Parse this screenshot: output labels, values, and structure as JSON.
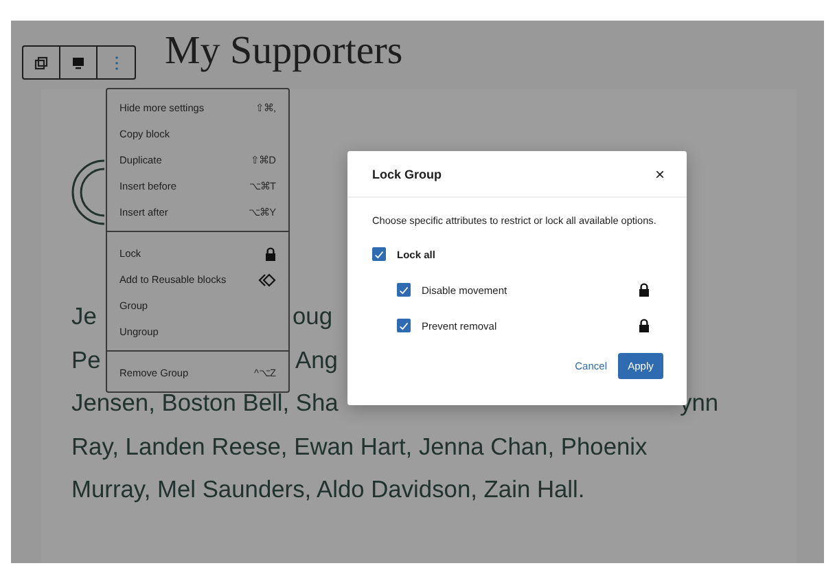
{
  "title": "My Supporters",
  "paragraph_lines": [
    [
      "Je",
      "oug"
    ],
    [
      "Pe",
      "Ang"
    ],
    [
      "Jensen, Boston Bell, Sha",
      "ynn"
    ],
    [
      "Ray, Landen Reese, Ewan Hart, Jenna Chan, Phoenix"
    ],
    [
      "Murray, Mel Saunders, Aldo Davidson, Zain Hall."
    ]
  ],
  "menu": {
    "groups": [
      [
        {
          "label": "Hide more settings",
          "kind": "shortcut",
          "shortcut": "⇧⌘,"
        },
        {
          "label": "Copy block",
          "kind": "plain"
        },
        {
          "label": "Duplicate",
          "kind": "shortcut",
          "shortcut": "⇧⌘D"
        },
        {
          "label": "Insert before",
          "kind": "shortcut",
          "shortcut": "⌥⌘T"
        },
        {
          "label": "Insert after",
          "kind": "shortcut",
          "shortcut": "⌥⌘Y"
        }
      ],
      [
        {
          "label": "Lock",
          "kind": "lock"
        },
        {
          "label": "Add to Reusable blocks",
          "kind": "reusable"
        },
        {
          "label": "Group",
          "kind": "plain"
        },
        {
          "label": "Ungroup",
          "kind": "plain"
        }
      ],
      [
        {
          "label": "Remove Group",
          "kind": "shortcut",
          "shortcut": "^⌥Z"
        }
      ]
    ]
  },
  "modal": {
    "title": "Lock Group",
    "close": "×",
    "description": "Choose specific attributes to restrict or lock all available options.",
    "lock_all": {
      "label": "Lock all",
      "checked": true
    },
    "options": [
      {
        "label": "Disable movement",
        "checked": true
      },
      {
        "label": "Prevent removal",
        "checked": true
      }
    ],
    "cancel": "Cancel",
    "apply": "Apply"
  }
}
